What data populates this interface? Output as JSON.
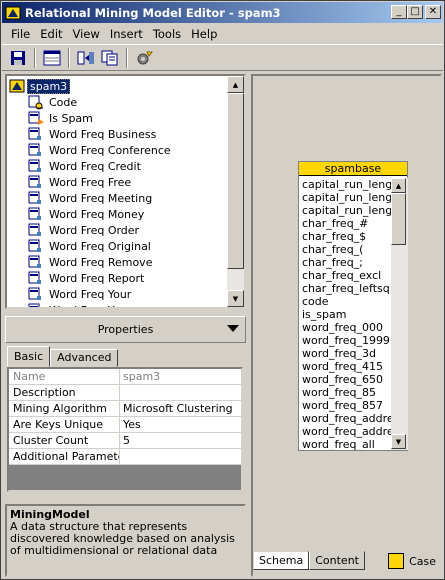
{
  "window": {
    "title": "Relational Mining Model Editor - spam3"
  },
  "menu": [
    "File",
    "Edit",
    "View",
    "Insert",
    "Tools",
    "Help"
  ],
  "toolbar": {
    "buttons": [
      "save-icon",
      "table-icon",
      "columns-icon",
      "copy-icon",
      "process-icon"
    ]
  },
  "tree": {
    "root": "spam3",
    "items": [
      {
        "label": "Code",
        "icon": "key-icon"
      },
      {
        "label": "Is Spam",
        "icon": "predict-icon"
      },
      {
        "label": "Word Freq Business",
        "icon": "column-icon"
      },
      {
        "label": "Word Freq Conference",
        "icon": "column-icon"
      },
      {
        "label": "Word Freq Credit",
        "icon": "column-icon"
      },
      {
        "label": "Word Freq Free",
        "icon": "column-icon"
      },
      {
        "label": "Word Freq Meeting",
        "icon": "column-icon"
      },
      {
        "label": "Word Freq Money",
        "icon": "column-icon"
      },
      {
        "label": "Word Freq Order",
        "icon": "column-icon"
      },
      {
        "label": "Word Freq Original",
        "icon": "column-icon"
      },
      {
        "label": "Word Freq Remove",
        "icon": "column-icon"
      },
      {
        "label": "Word Freq Report",
        "icon": "column-icon"
      },
      {
        "label": "Word Freq Your",
        "icon": "column-icon"
      },
      {
        "label": "Word Freq You",
        "icon": "column-icon"
      }
    ]
  },
  "properties": {
    "header": "Properties",
    "tabs": [
      "Basic",
      "Advanced"
    ],
    "rows": [
      {
        "key": "Name",
        "value": "spam3",
        "disabled": true
      },
      {
        "key": "Description",
        "value": ""
      },
      {
        "key": "Mining Algorithm",
        "value": "Microsoft Clustering"
      },
      {
        "key": "Are Keys Unique",
        "value": "Yes"
      },
      {
        "key": "Cluster Count",
        "value": "5"
      },
      {
        "key": "Additional Parameters",
        "value": ""
      }
    ]
  },
  "description": {
    "title": "MiningModel",
    "text": "A data structure that represents discovered knowledge based on analysis of multidimensional or relational data"
  },
  "schema": {
    "table_name": "spambase",
    "columns": [
      "capital_run_length",
      "capital_run_length",
      "capital_run_length",
      "char_freq_#",
      "char_freq_$",
      "char_freq_(",
      "char_freq_;",
      "char_freq_excl",
      "char_freq_leftsq",
      "code",
      "is_spam",
      "word_freq_000",
      "word_freq_1999",
      "word_freq_3d",
      "word_freq_415",
      "word_freq_650",
      "word_freq_85",
      "word_freq_857",
      "word_freq_addres",
      "word_freq_addres",
      "word_freq_all"
    ],
    "tabs": [
      "Schema",
      "Content"
    ],
    "legend": "Case",
    "table_color": "#ffd700"
  }
}
